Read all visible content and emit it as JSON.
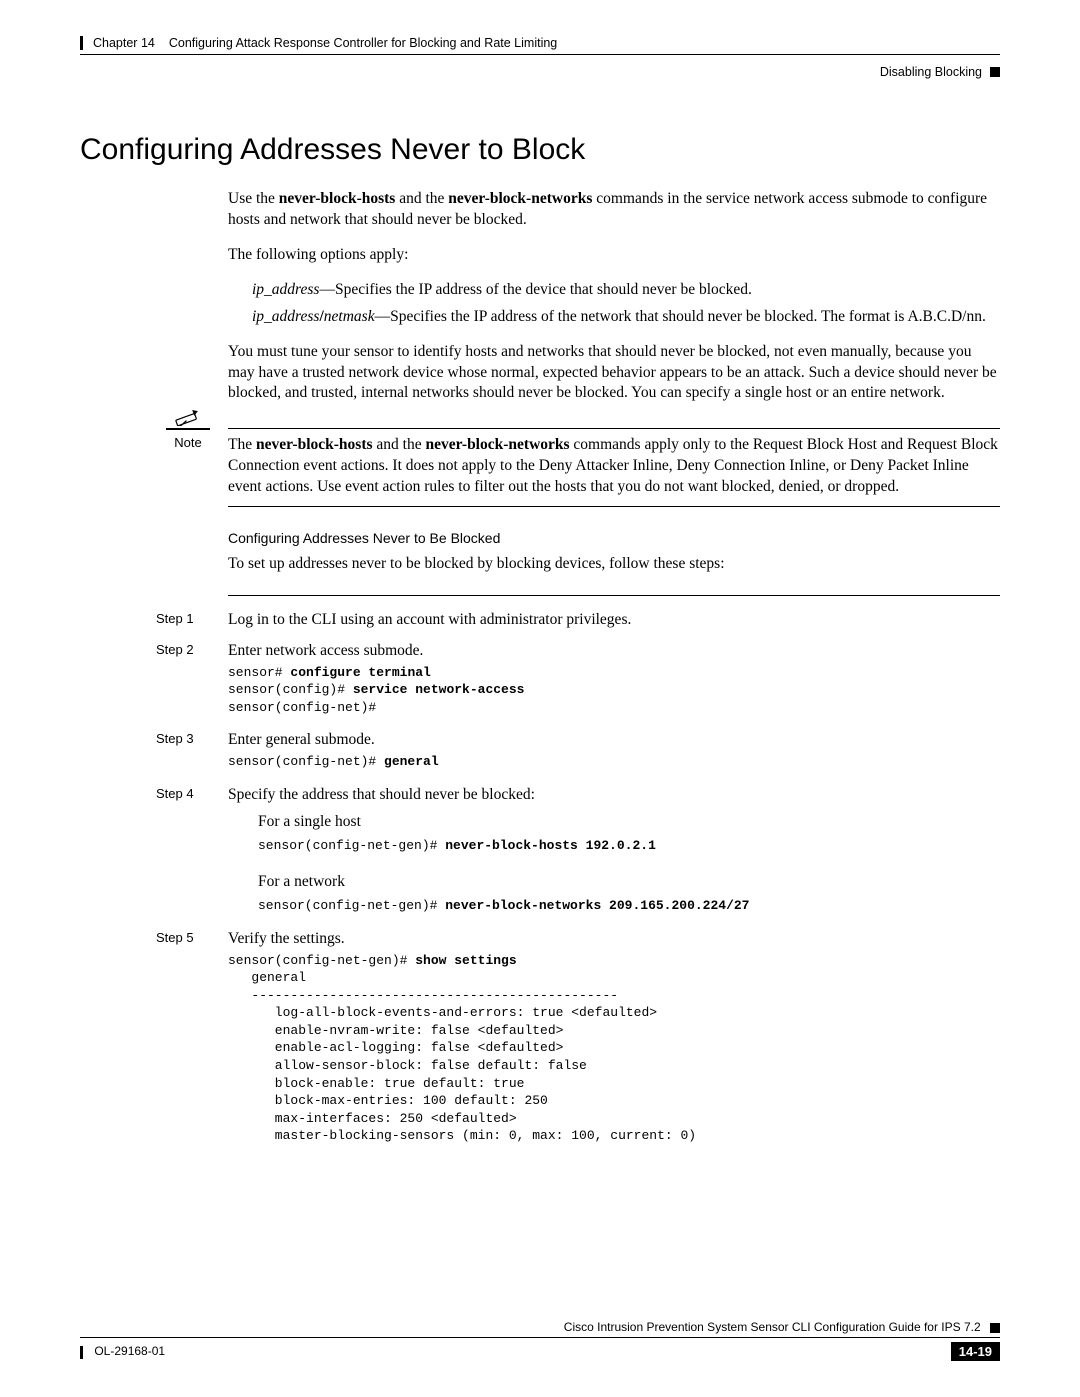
{
  "header": {
    "chapter": "Chapter 14",
    "chapter_title": "Configuring Attack Response Controller for Blocking and Rate Limiting",
    "sub_right": "Disabling Blocking"
  },
  "title": "Configuring Addresses Never to Block",
  "intro": {
    "p1_a": "Use the ",
    "p1_b1": "never-block-hosts",
    "p1_c": " and the ",
    "p1_b2": "never-block-networks",
    "p1_d": " commands in the service network access submode to configure hosts and network that should never be blocked.",
    "p2": "The following options apply:",
    "opt1_i": "ip_address",
    "opt1_t": "—Specifies the IP address of the device that should never be blocked.",
    "opt2_i1": "ip_address",
    "opt2_slash": "/",
    "opt2_i2": "netmask",
    "opt2_t": "—Specifies the IP address of the network that should never be blocked. The format is A.B.C.D/nn.",
    "p3": "You must tune your sensor to identify hosts and networks that should never be blocked, not even manually, because you may have a trusted network device whose normal, expected behavior appears to be an attack. Such a device should never be blocked, and trusted, internal networks should never be blocked. You can specify a single host or an entire network."
  },
  "note": {
    "label": "Note",
    "a": "The ",
    "b1": "never-block-hosts",
    "c": " and the ",
    "b2": "never-block-networks",
    "d": " commands apply only to the Request Block Host and Request Block Connection event actions. It does not apply to the Deny Attacker Inline, Deny Connection Inline, or Deny Packet Inline event actions. Use event action rules to filter out the hosts that you do not want blocked, denied, or dropped."
  },
  "subhead": "Configuring Addresses Never to Be Blocked",
  "subtext": "To set up addresses never to be blocked by blocking devices, follow these steps:",
  "steps": {
    "s1": {
      "label": "Step 1",
      "text": "Log in to the CLI using an account with administrator privileges."
    },
    "s2": {
      "label": "Step 2",
      "text": "Enter network access submode.",
      "code_l1p": "sensor# ",
      "code_l1b": "configure terminal",
      "code_l2p": "sensor(config)# ",
      "code_l2b": "service network-access",
      "code_l3": "sensor(config-net)# "
    },
    "s3": {
      "label": "Step 3",
      "text": "Enter general submode.",
      "code_p": "sensor(config-net)# ",
      "code_b": "general"
    },
    "s4": {
      "label": "Step 4",
      "text": "Specify the address that should never be blocked:",
      "host_label": "For a single host",
      "host_code_p": "sensor(config-net-gen)# ",
      "host_code_b": "never-block-hosts 192.0.2.1",
      "net_label": "For a network",
      "net_code_p": "sensor(config-net-gen)# ",
      "net_code_b": "never-block-networks 209.165.200.224/27"
    },
    "s5": {
      "label": "Step 5",
      "text": "Verify the settings.",
      "code_p": "sensor(config-net-gen)# ",
      "code_b": "show settings",
      "code_rest": "\n   general\n   -----------------------------------------------\n      log-all-block-events-and-errors: true <defaulted>\n      enable-nvram-write: false <defaulted>\n      enable-acl-logging: false <defaulted>\n      allow-sensor-block: false default: false\n      block-enable: true default: true\n      block-max-entries: 100 default: 250\n      max-interfaces: 250 <defaulted>\n      master-blocking-sensors (min: 0, max: 100, current: 0)"
    }
  },
  "footer": {
    "guide": "Cisco Intrusion Prevention System Sensor CLI Configuration Guide for IPS 7.2",
    "doc": "OL-29168-01",
    "page": "14-19"
  }
}
